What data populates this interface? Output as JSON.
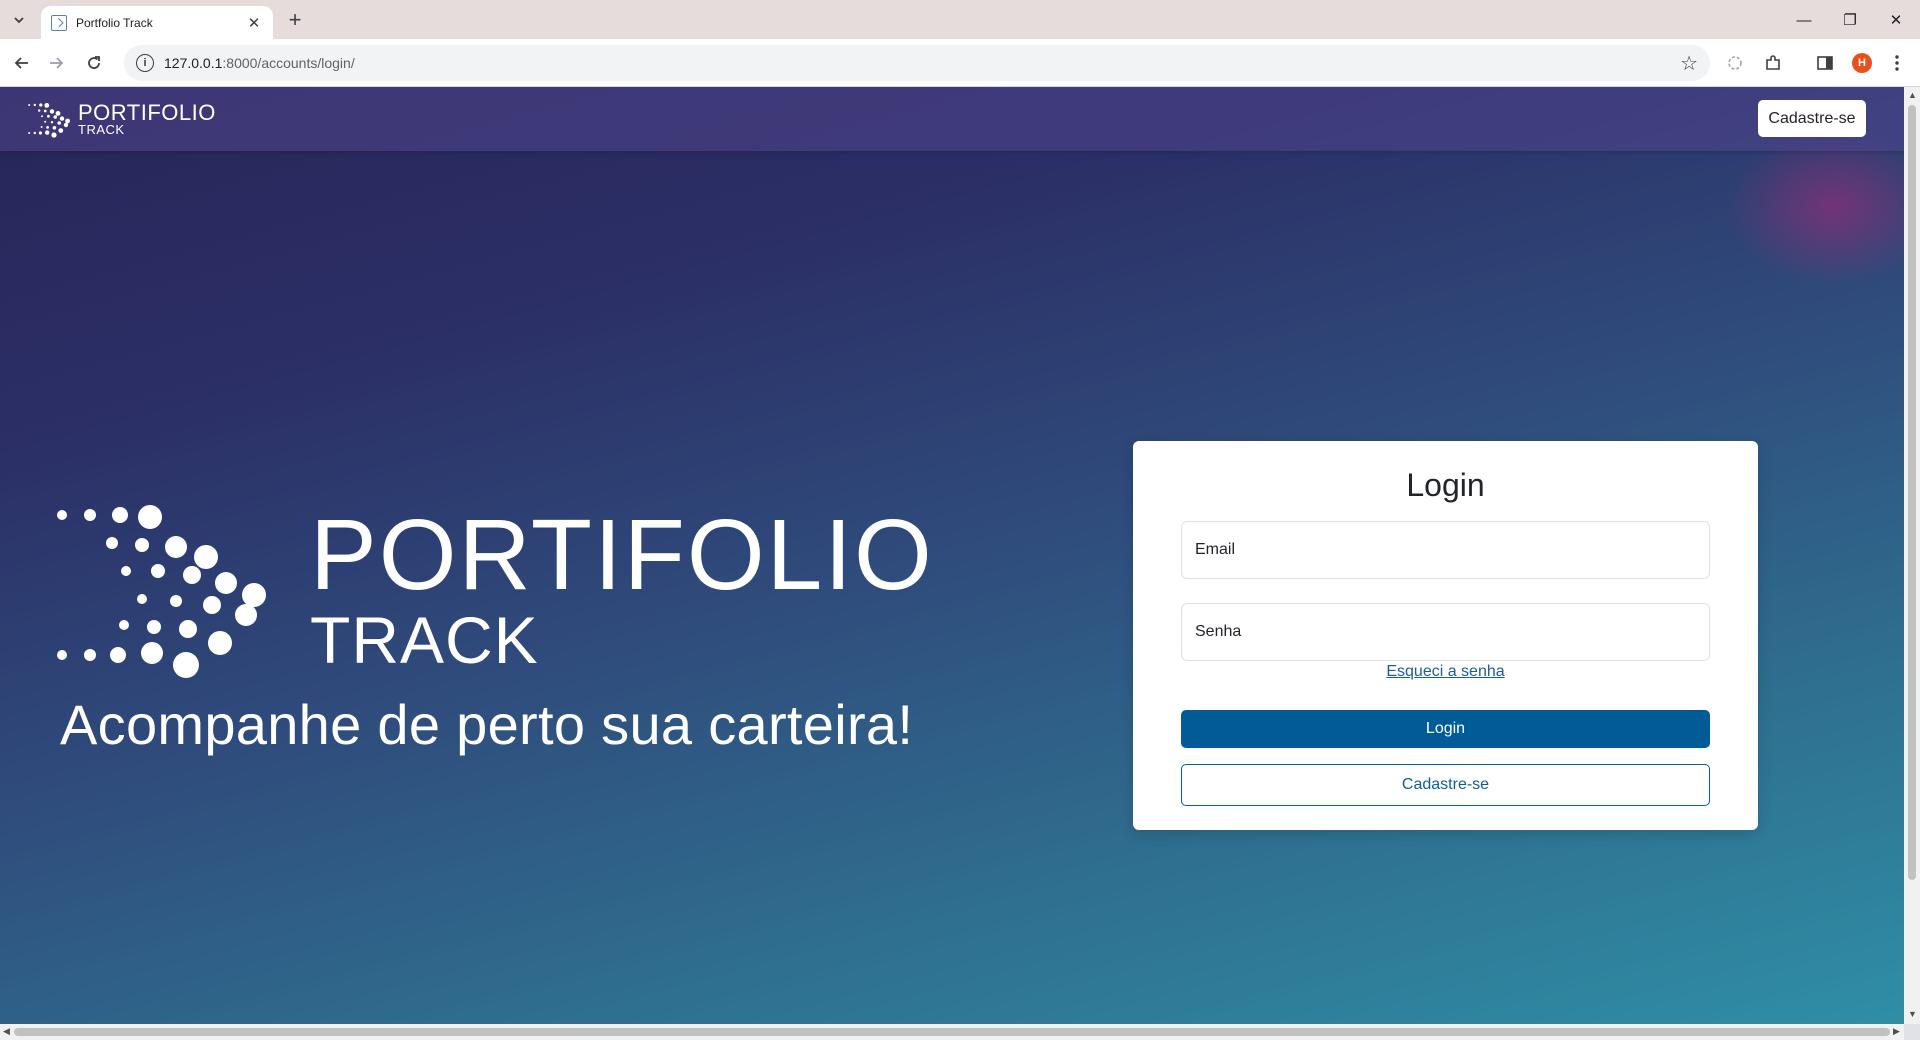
{
  "browser": {
    "tab_title": "Portfolio Track",
    "tab_close": "✕",
    "new_tab": "+",
    "url_host": "127.0.0.1",
    "url_rest": ":8000/accounts/login/",
    "profile_initial": "H",
    "window_minimize": "—",
    "window_restore": "❐",
    "window_close": "✕"
  },
  "navbar": {
    "brand_line1": "PORTIFOLIO",
    "brand_line2": "TRACK",
    "signup_label": "Cadastre-se"
  },
  "hero": {
    "brand_line1": "PORTIFOLIO",
    "brand_line2": "TRACK",
    "tagline": "Acompanhe de perto sua carteira!"
  },
  "login_card": {
    "title": "Login",
    "email_placeholder": "Email",
    "password_placeholder": "Senha",
    "forgot_password": "Esqueci a senha",
    "login_button": "Login",
    "signup_button": "Cadastre-se"
  },
  "colors": {
    "primary_button": "#005b96",
    "link": "#1a5e9a",
    "bg_top": "#272558",
    "bg_bottom": "#2f8ea6"
  }
}
